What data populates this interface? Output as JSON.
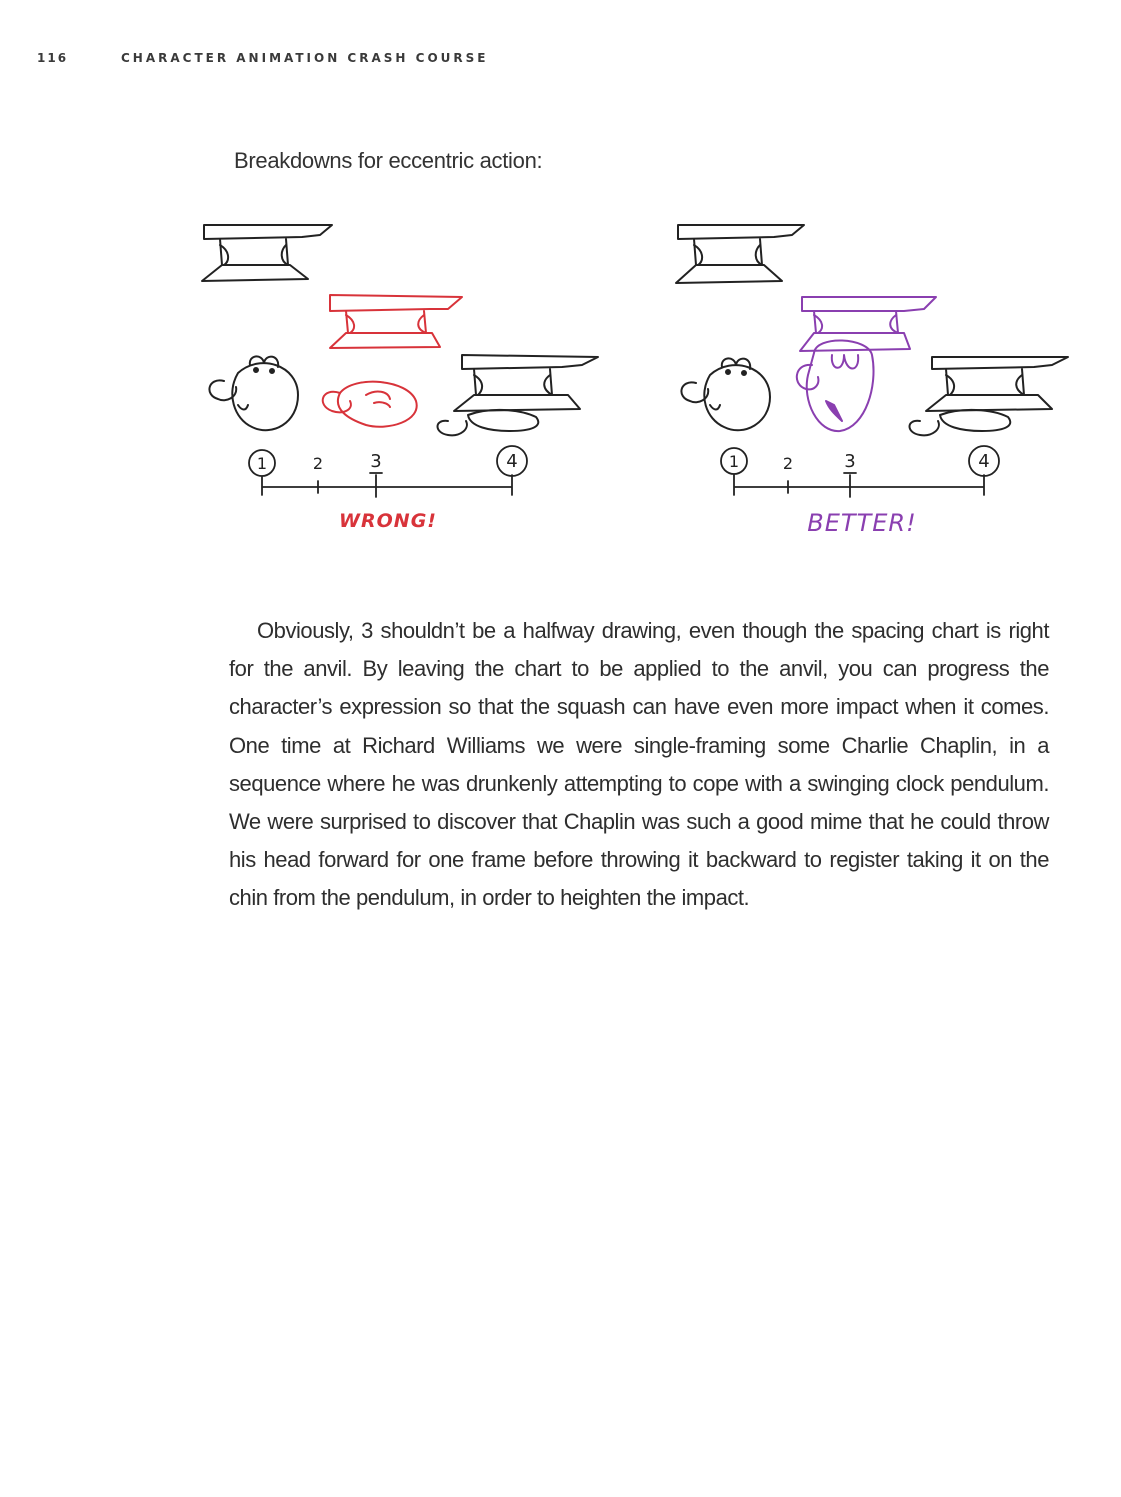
{
  "header": {
    "page_number": "116",
    "running_title": "CHARACTER ANIMATION CRASH COURSE"
  },
  "caption": "Breakdowns for eccentric action:",
  "figures": [
    {
      "ticks": [
        "1",
        "2",
        "3",
        "4"
      ],
      "label": "WRONG!",
      "accent": "#d8333a"
    },
    {
      "ticks": [
        "1",
        "2",
        "3",
        "4"
      ],
      "label": "BETTER!",
      "accent": "#8a3fb0"
    }
  ],
  "body_paragraph": "Obviously, 3 shouldn’t be a halfway drawing, even though the spacing chart is right for the anvil. By leaving the chart to be applied to the anvil, you can progress the character’s expression so that the squash can have even more impact when it comes. One time at Richard Williams we were single-framing some Charlie Chaplin, in a sequence where he was drunkenly attempting to cope with a swinging clock pendulum. We were surprised to discover that Chaplin was such a good mime that he could throw his head forward for one frame before throwing it backward to register taking it on the chin from the pendulum, in order to heighten the impact."
}
